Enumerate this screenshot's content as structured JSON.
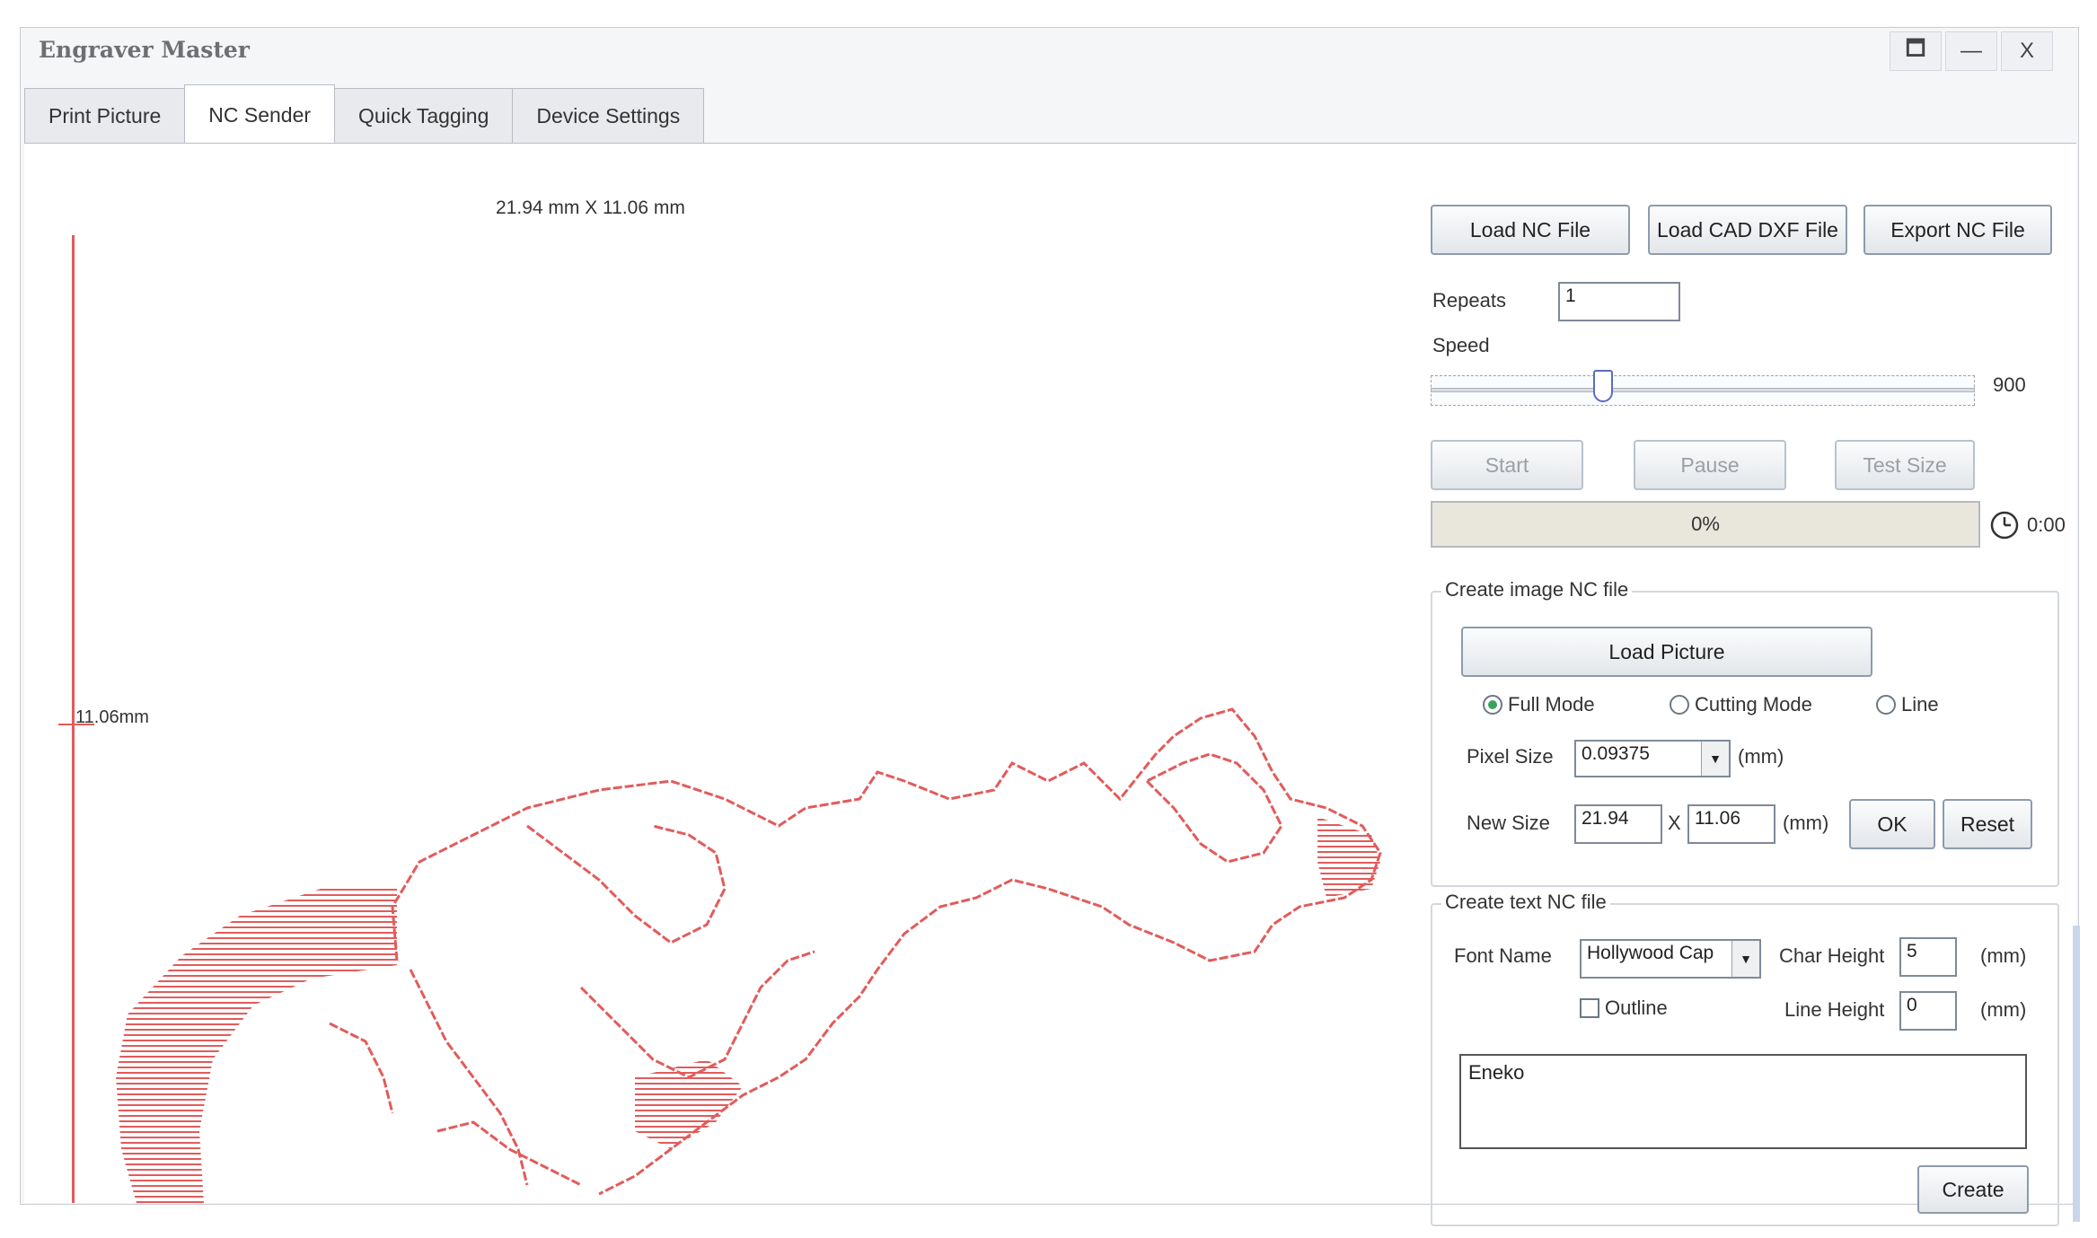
{
  "window": {
    "title": "Engraver Master",
    "controls": {
      "restore": "🗖",
      "minimize": "—",
      "close": "X"
    }
  },
  "tabs": [
    {
      "label": "Print Picture",
      "active": false
    },
    {
      "label": "NC Sender",
      "active": true
    },
    {
      "label": "Quick Tagging",
      "active": false
    },
    {
      "label": "Device Settings",
      "active": false
    }
  ],
  "canvas": {
    "dimensions_label": "21.94 mm X 11.06 mm",
    "y_axis_label": "11.06mm",
    "stroke_color": "#e25b5b"
  },
  "toolbar": {
    "load_nc": "Load NC File",
    "load_dxf": "Load CAD DXF File",
    "export_nc": "Export NC File"
  },
  "repeats": {
    "label": "Repeats",
    "value": "1"
  },
  "speed": {
    "label": "Speed",
    "value": "900",
    "level_fraction": 0.31
  },
  "controls": {
    "start": "Start",
    "pause": "Pause",
    "test_size": "Test Size"
  },
  "progress": {
    "percent_text": "0%",
    "fraction": 0,
    "time": "0:00"
  },
  "image_nc": {
    "legend": "Create image NC file",
    "load_picture": "Load Picture",
    "modes": [
      {
        "label": "Full Mode",
        "selected": true
      },
      {
        "label": "Cutting Mode",
        "selected": false
      },
      {
        "label": "Line",
        "selected": false
      }
    ],
    "pixel_size_label": "Pixel Size",
    "pixel_size_value": "0.09375",
    "pixel_unit": "(mm)",
    "new_size_label": "New Size",
    "width_value": "21.94",
    "x_sep": "X",
    "height_value": "11.06",
    "size_unit": "(mm)",
    "ok": "OK",
    "reset": "Reset"
  },
  "text_nc": {
    "legend": "Create text NC file",
    "font_name_label": "Font Name",
    "font_name_value": "Hollywood Cap",
    "char_height_label": "Char Height",
    "char_height_value": "5",
    "char_unit": "(mm)",
    "outline_label": "Outline",
    "outline_checked": false,
    "line_height_label": "Line Height",
    "line_height_value": "0",
    "line_unit": "(mm)",
    "text_value": "Eneko",
    "create": "Create"
  },
  "colors": {
    "accent_green": "#3aa35a",
    "engrave_red": "#e25b5b",
    "slider_thumb": "#5b6cc4"
  }
}
